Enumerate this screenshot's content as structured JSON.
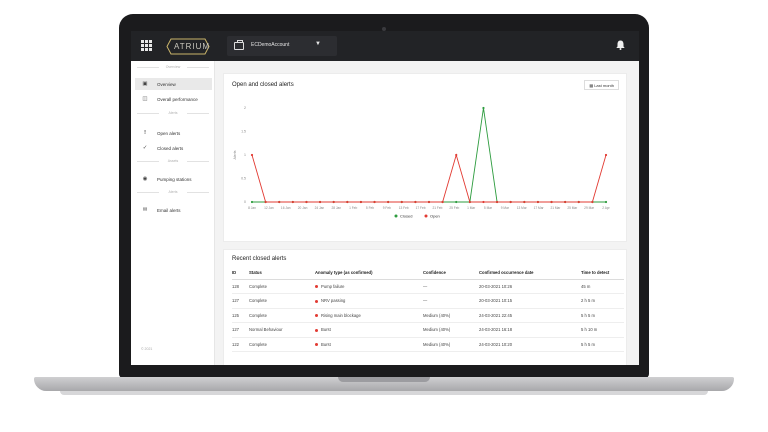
{
  "topbar": {
    "logo_text": "ATRIUM",
    "account_label": "ECDemoAccount",
    "icons": [
      "apps-grid-icon",
      "briefcase-icon",
      "chevron-down-icon",
      "bell-icon"
    ]
  },
  "sidebar": {
    "sections": [
      {
        "label": "Overview",
        "items": [
          {
            "label": "Overview",
            "icon": "dashboard-icon",
            "active": true
          },
          {
            "label": "Overall performance",
            "icon": "gauge-icon",
            "active": false
          }
        ]
      },
      {
        "label": "Alerts",
        "items": [
          {
            "label": "Open alerts",
            "icon": "exclamation-icon",
            "active": false
          },
          {
            "label": "Closed alerts",
            "icon": "check-icon",
            "active": false
          }
        ]
      },
      {
        "label": "Assets",
        "items": [
          {
            "label": "Pumping stations",
            "icon": "drop-icon",
            "active": false
          }
        ]
      },
      {
        "label": "Alerts",
        "items": [
          {
            "label": "Email alerts",
            "icon": "envelope-icon",
            "active": false
          }
        ]
      }
    ],
    "footer": "© 2021"
  },
  "chart_card": {
    "title": "Open and closed alerts",
    "button_label": "Last month"
  },
  "chart_data": {
    "type": "line",
    "title": "Open and closed alerts",
    "ylabel": "Alerts",
    "xlabel": "",
    "ylim": [
      0,
      2
    ],
    "yticks": [
      "0",
      "0.5",
      "1",
      "1.5",
      "2"
    ],
    "x": [
      "8 Jan",
      "",
      "",
      "",
      "12 Jan",
      "",
      "",
      "",
      "16 Jan",
      "",
      "",
      "",
      "20 Jan",
      "",
      "",
      "",
      "24 Jan",
      "",
      "",
      "",
      "28 Jan",
      "",
      "",
      "",
      "1 Feb",
      "",
      "",
      "",
      "5 Feb",
      "",
      "",
      "",
      "9 Feb",
      "",
      "",
      "",
      "13 Feb",
      "",
      "",
      "",
      "17 Feb",
      "",
      "",
      "",
      "21 Feb",
      "",
      "",
      "",
      "25 Feb",
      "",
      "",
      "",
      "1 Mar",
      "",
      "",
      "",
      "5 Mar",
      "",
      "",
      "",
      "9 Mar",
      "",
      "",
      "",
      "13 Mar",
      "",
      "",
      "",
      "17 Mar",
      "",
      "",
      "",
      "21 Mar",
      "",
      "",
      "",
      "25 Mar",
      "",
      "",
      "",
      "29 Mar",
      "",
      "",
      "",
      "2 Apr"
    ],
    "x_labels": [
      "8 Jan",
      "12 Jan",
      "16 Jan",
      "20 Jan",
      "24 Jan",
      "28 Jan",
      "1 Feb",
      "5 Feb",
      "9 Feb",
      "13 Feb",
      "17 Feb",
      "21 Feb",
      "25 Feb",
      "1 Mar",
      "5 Mar",
      "9 Mar",
      "13 Mar",
      "17 Mar",
      "21 Mar",
      "25 Mar",
      "29 Mar",
      "2 Apr"
    ],
    "points": 27,
    "series": [
      {
        "name": "Closed",
        "color": "#2e9c3f",
        "values": [
          0,
          0,
          0,
          0,
          0,
          0,
          0,
          0,
          0,
          0,
          0,
          0,
          0,
          0,
          0,
          0,
          0,
          2,
          0,
          0,
          0,
          0,
          0,
          0,
          0,
          0,
          0
        ]
      },
      {
        "name": "Open",
        "color": "#e23b33",
        "values": [
          1,
          0,
          0,
          0,
          0,
          0,
          0,
          0,
          0,
          0,
          0,
          0,
          0,
          0,
          0,
          1,
          0,
          0,
          0,
          0,
          0,
          0,
          0,
          0,
          0,
          0,
          1
        ]
      }
    ],
    "legend": "bottom",
    "grid": false
  },
  "table": {
    "title": "Recent closed alerts",
    "headers": [
      "ID",
      "Status",
      "Anomaly type (as confirmed)",
      "Confidence",
      "Confirmed occurrence date",
      "Time to detect"
    ],
    "rows": [
      {
        "id": "128",
        "status": "Complete",
        "anomaly": "Pump failure",
        "confidence": "—",
        "date": "20-03-2021 10:26",
        "ttd": "45 m"
      },
      {
        "id": "127",
        "status": "Complete",
        "anomaly": "NRV passing",
        "confidence": "—",
        "date": "20-03-2021 10:15",
        "ttd": "2 h 5 m"
      },
      {
        "id": "125",
        "status": "Complete",
        "anomaly": "Rising main blockage",
        "confidence": "Medium (40%)",
        "date": "24-03-2021 22:45",
        "ttd": "5 h 5 m"
      },
      {
        "id": "127",
        "status": "Normal Behaviour",
        "anomaly": "Burst",
        "confidence": "Medium (40%)",
        "date": "24-03-2021 16:18",
        "ttd": "5 h 10 m"
      },
      {
        "id": "122",
        "status": "Complete",
        "anomaly": "Burst",
        "confidence": "Medium (40%)",
        "date": "24-03-2021 10:20",
        "ttd": "5 h 5 m"
      }
    ]
  },
  "colors": {
    "topbar": "#222326",
    "closed": "#2e9c3f",
    "open": "#e23b33",
    "accent": "#c9b46a"
  }
}
